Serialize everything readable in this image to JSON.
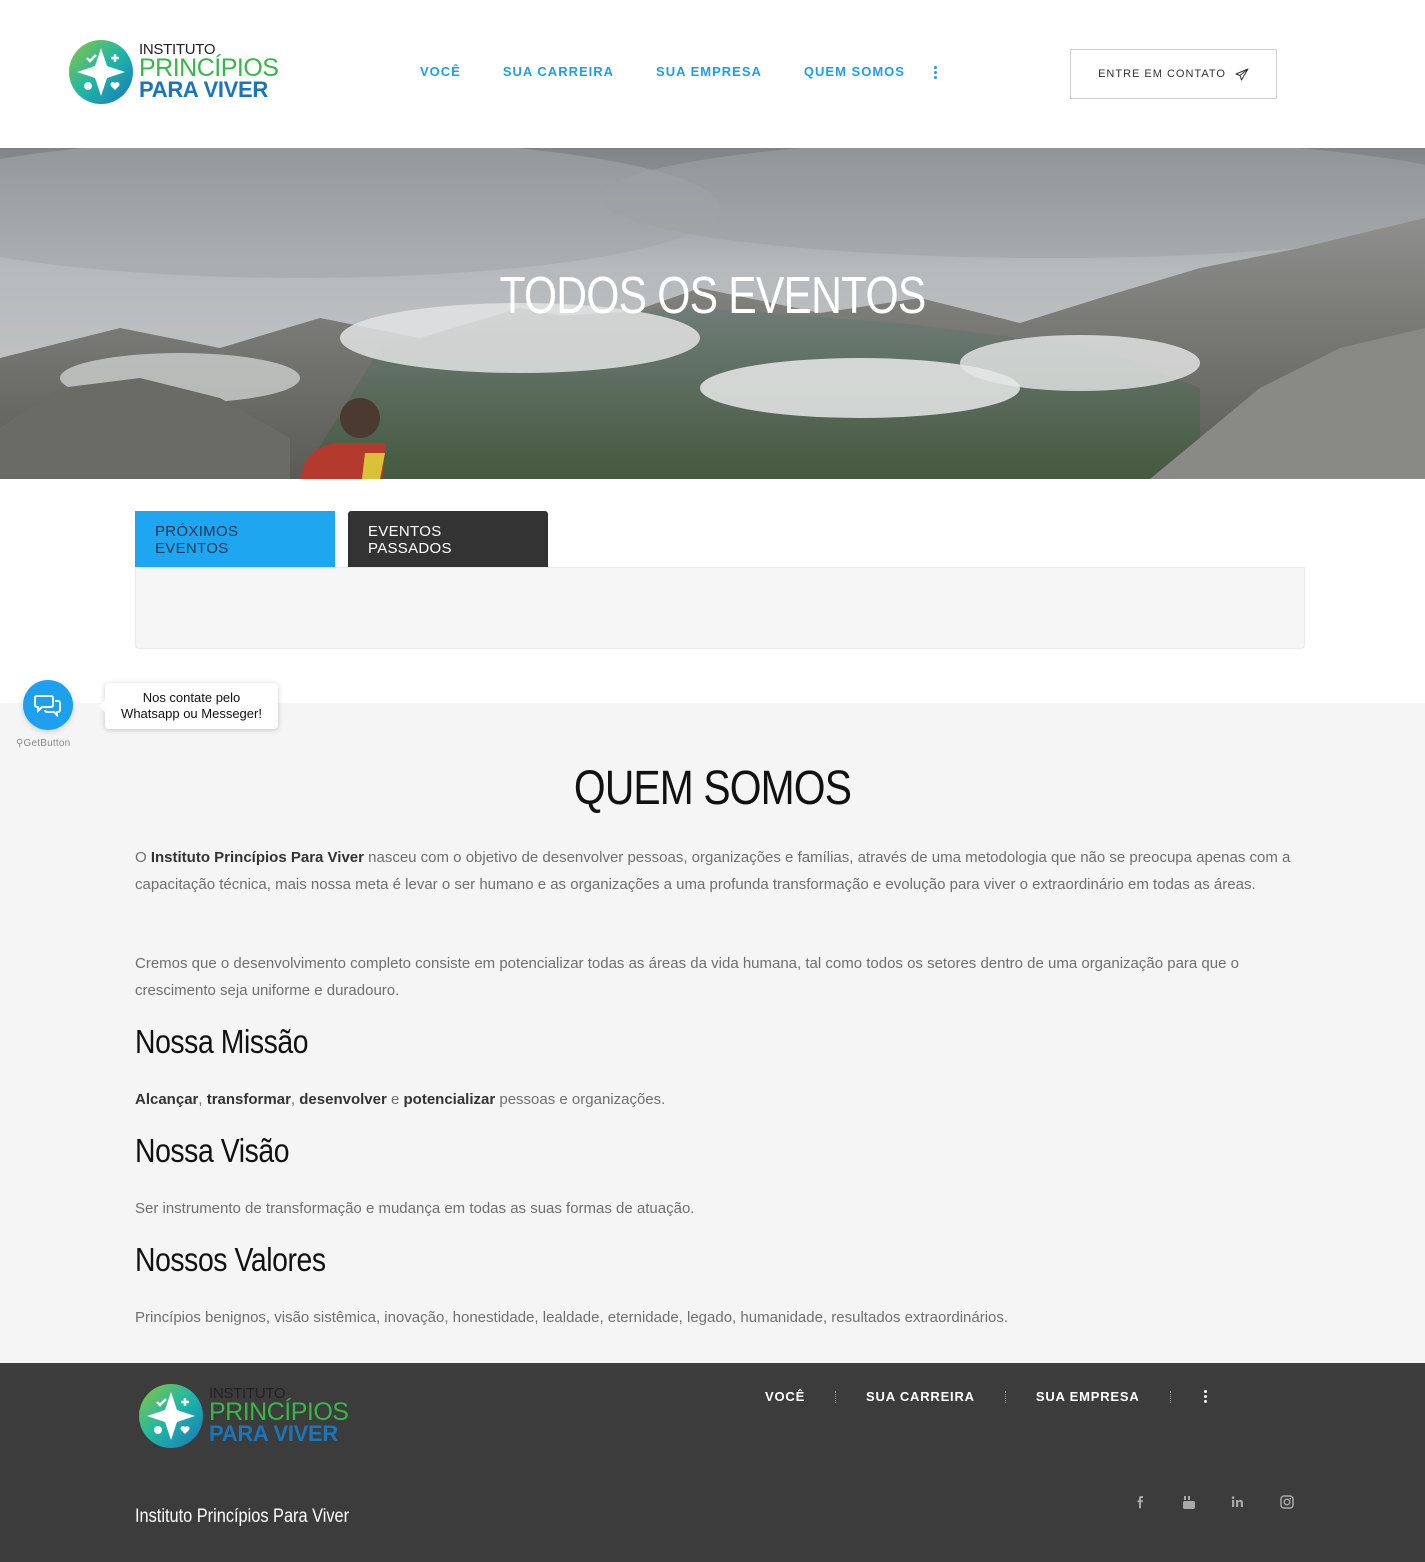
{
  "header": {
    "logo": {
      "line1": "INSTITUTO",
      "line2": "PRINCÍPIOS",
      "line3": "PARA VIVER"
    },
    "nav": [
      "VOCÊ",
      "SUA CARREIRA",
      "SUA EMPRESA",
      "QUEM SOMOS"
    ],
    "more_icon": "vertical-dots-icon",
    "contact_button": "ENTRE EM CONTATO",
    "contact_icon": "paper-plane-icon"
  },
  "hero": {
    "title": "TODOS OS EVENTOS"
  },
  "tabs": {
    "upcoming": "PRÓXIMOS EVENTOS",
    "past": "EVENTOS PASSADOS"
  },
  "about": {
    "title": "QUEM SOMOS",
    "intro_prefix": "O ",
    "intro_bold": "Instituto Princípios Para Viver",
    "intro_rest": " nasceu com o objetivo de desenvolver pessoas, organizações e famílias, através de uma metodologia que não se preocupa apenas com a capacitação técnica, mais nossa meta é levar o ser humano e as organizações a uma profunda transformação e evolução para viver o extraordinário em todas as áreas.",
    "paragraph2": "Cremos que o desenvolvimento completo consiste em potencializar todas as áreas da vida humana, tal como todos os setores dentro de uma organização para que o crescimento seja uniforme e duradouro.",
    "mission_title": "Nossa Missão",
    "mission": {
      "w1": "Alcançar",
      "s1": ", ",
      "w2": "transformar",
      "s2": ", ",
      "w3": "desenvolver",
      "s3": " e ",
      "w4": "potencializar",
      "rest": " pessoas e organizações."
    },
    "vision_title": "Nossa Visão",
    "vision": "Ser instrumento de transformação e mudança em todas as suas formas de atuação.",
    "values_title": "Nossos Valores",
    "values": "Princípios benignos, visão sistêmica, inovação, honestidade, lealdade, eternidade, legado, humanidade, resultados extraordinários."
  },
  "widget": {
    "tooltip_line1": "Nos contate pelo",
    "tooltip_line2": "Whatsapp ou Messeger!",
    "brand": "GetButton",
    "icon": "chat-bubbles-icon"
  },
  "footer": {
    "nav": [
      "VOCÊ",
      "SUA CARREIRA",
      "SUA EMPRESA"
    ],
    "copyright": "Instituto Princípios Para Viver",
    "social": [
      "facebook-icon",
      "youtube-icon",
      "linkedin-icon",
      "instagram-icon"
    ]
  },
  "colors": {
    "accent": "#1e9ee8",
    "dark": "#333333",
    "footer": "#3c3c3c",
    "logo_green": "#39b54a",
    "logo_blue": "#1b75bb"
  }
}
